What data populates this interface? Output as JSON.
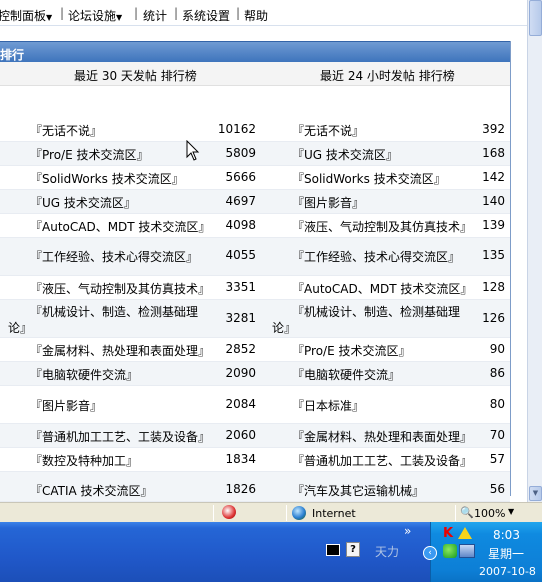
{
  "menubar": {
    "items": [
      {
        "label": "控制面板",
        "has_dropdown": true
      },
      {
        "label": "论坛设施",
        "has_dropdown": true
      },
      {
        "label": "统计",
        "has_dropdown": false
      },
      {
        "label": "系统设置",
        "has_dropdown": false
      },
      {
        "label": "帮助",
        "has_dropdown": false
      }
    ],
    "separator": "|",
    "dropdown_glyph": "▼"
  },
  "board": {
    "title": "排行",
    "left_header": "最近 30 天发帖 排行榜",
    "right_header": "最近 24 小时发帖 排行榜",
    "rows": [
      {
        "left_name": "『无话不说』",
        "left_value": "10162",
        "right_name": "『无话不说』",
        "right_value": "392"
      },
      {
        "left_name": "『Pro/E 技术交流区』",
        "left_value": "5809",
        "right_name": "『UG 技术交流区』",
        "right_value": "168"
      },
      {
        "left_name": "『SolidWorks 技术交流区』",
        "left_value": "5666",
        "right_name": "『SolidWorks 技术交流区』",
        "right_value": "142"
      },
      {
        "left_name": "『UG 技术交流区』",
        "left_value": "4697",
        "right_name": "『图片影音』",
        "right_value": "140"
      },
      {
        "left_name": "『AutoCAD、MDT 技术交流区』",
        "left_value": "4098",
        "right_name": "『液压、气动控制及其仿真技术』",
        "right_value": "139"
      },
      {
        "left_name": "『工作经验、技术心得交流区』",
        "left_value": "4055",
        "right_name": "『工作经验、技术心得交流区』",
        "right_value": "135"
      },
      {
        "left_name": "『液压、气动控制及其仿真技术』",
        "left_value": "3351",
        "right_name": "『AutoCAD、MDT 技术交流区』",
        "right_value": "128"
      },
      {
        "left_name_line1": "『机械设计、制造、检测基础理",
        "left_name_line2": "论』",
        "left_value": "3281",
        "right_name_line1": "『机械设计、制造、检测基础理",
        "right_name_line2": "论』",
        "right_value": "126"
      },
      {
        "left_name": "『金属材料、热处理和表面处理』",
        "left_value": "2852",
        "right_name": "『Pro/E 技术交流区』",
        "right_value": "90"
      },
      {
        "left_name": "『电脑软硬件交流』",
        "left_value": "2090",
        "right_name": "『电脑软硬件交流』",
        "right_value": "86"
      },
      {
        "left_name": "『图片影音』",
        "left_value": "2084",
        "right_name": "『日本标准』",
        "right_value": "80"
      },
      {
        "left_name": "『普通机加工工艺、工装及设备』",
        "left_value": "2060",
        "right_name": "『金属材料、热处理和表面处理』",
        "right_value": "70"
      },
      {
        "left_name": "『数控及特种加工』",
        "left_value": "1834",
        "right_name": "『普通机加工工艺、工装及设备』",
        "right_value": "57"
      },
      {
        "left_name": "『CATIA 技术交流区』",
        "left_value": "1826",
        "right_name": "『汽车及其它运输机械』",
        "right_value": "56"
      }
    ]
  },
  "statusbar": {
    "zone": "Internet",
    "zoom": "100%"
  },
  "taskbar": {
    "chevron": "»",
    "ime_label": "天力",
    "ime_help": "?",
    "tray_toggle": "‹",
    "tray_k": "K",
    "time": "8:03",
    "weekday": "星期一",
    "date": "2007-10-8"
  }
}
